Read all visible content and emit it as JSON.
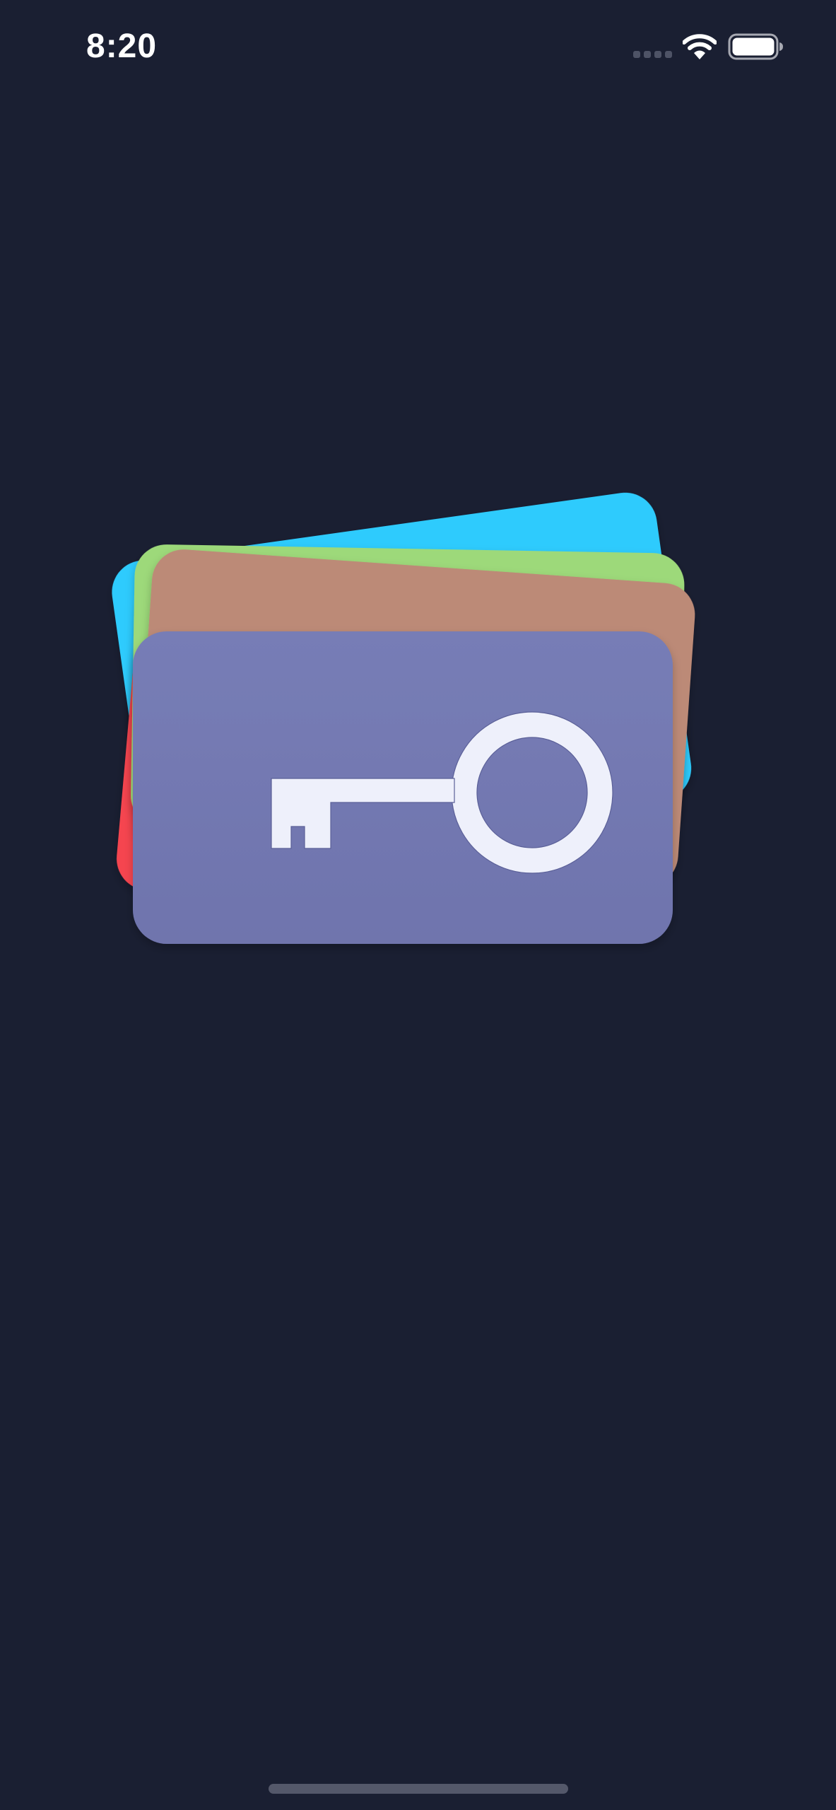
{
  "status_bar": {
    "time": "8:20",
    "signal_icon": "cellular-signal-dots-icon",
    "wifi_icon": "wifi-icon",
    "battery_icon": "battery-icon"
  },
  "splash": {
    "logo_icon": "stacked-cards-key-icon",
    "card_colors": {
      "blue": "#2ecbfd",
      "green": "#9dd97a",
      "brown": "#bc8a77",
      "red": "#f5454f",
      "front": "#7479b2",
      "key": "#eef0fb"
    }
  },
  "colors": {
    "background": "#1a1f32",
    "home_indicator": "#54586a"
  }
}
